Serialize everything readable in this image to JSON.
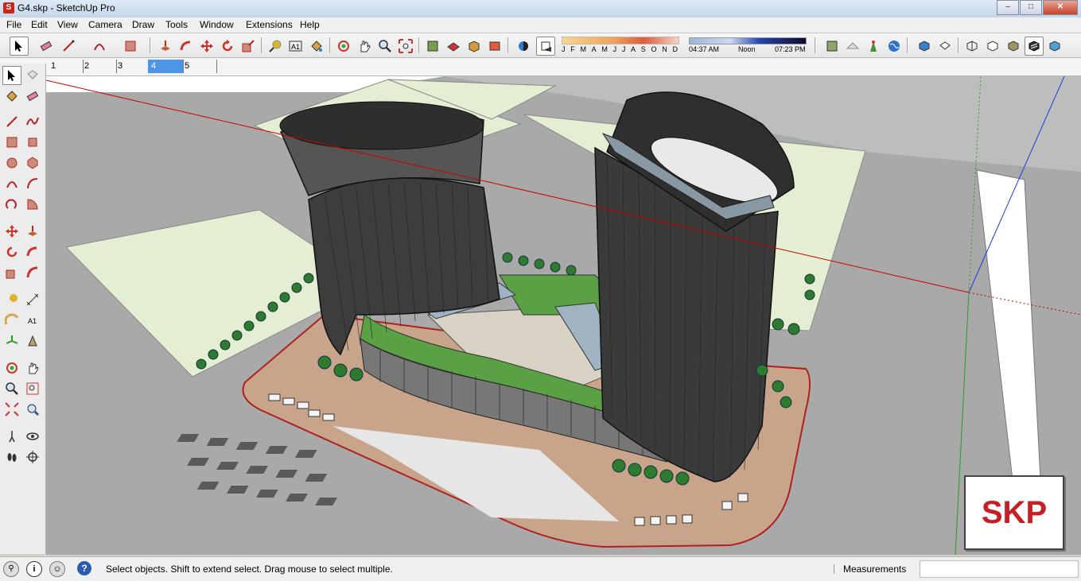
{
  "window": {
    "title": "G4.skp - SketchUp Pro",
    "min": "–",
    "max": "□",
    "close": "✕"
  },
  "menu": [
    "File",
    "Edit",
    "View",
    "Camera",
    "Draw",
    "Tools",
    "Window",
    "Extensions",
    "Help"
  ],
  "shadow": {
    "months": [
      "J",
      "F",
      "M",
      "A",
      "M",
      "J",
      "J",
      "A",
      "S",
      "O",
      "N",
      "D"
    ],
    "time_start": "04:37 AM",
    "time_mid": "Noon",
    "time_end": "07:23 PM"
  },
  "scenes": [
    "1",
    "2",
    "3",
    "4",
    "5"
  ],
  "selected_scene": "4",
  "status": {
    "text": "Select objects. Shift to extend select. Drag mouse to select multiple.",
    "measurements_label": "Measurements",
    "measurements_value": ""
  },
  "badge": "SKP",
  "colors": {
    "red_axis": "#cc0000",
    "green_axis": "#2a9a2a",
    "blue_axis": "#1a3fd6",
    "grass": "#e4eed3",
    "ground": "#a8a8a8",
    "badge_red": "#c52027"
  }
}
